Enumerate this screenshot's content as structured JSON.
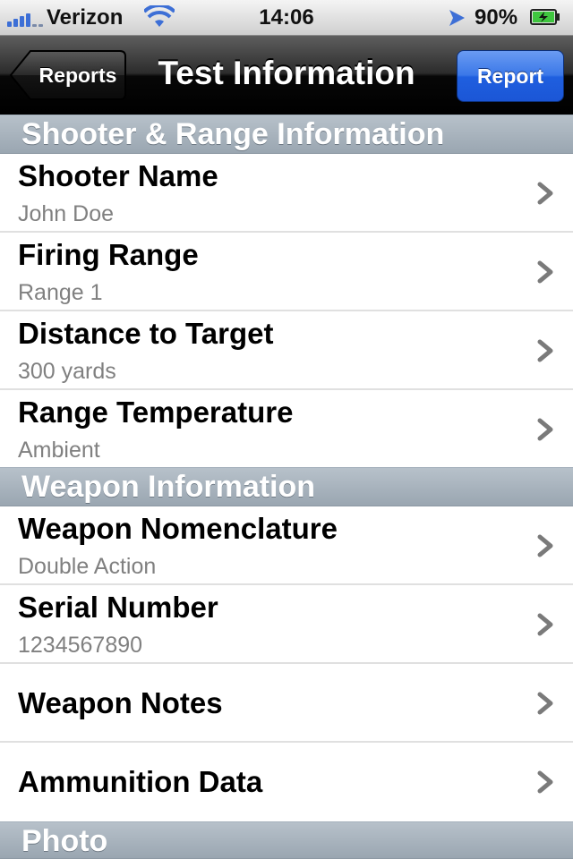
{
  "status_bar": {
    "carrier": "Verizon",
    "time": "14:06",
    "battery_percent": "90%",
    "signal_bars": 4,
    "icons": [
      "signal-icon",
      "wifi-icon",
      "location-arrow-icon",
      "battery-charging-icon"
    ]
  },
  "nav": {
    "back_label": "Reports",
    "title": "Test Information",
    "report_label": "Report"
  },
  "colors": {
    "section_header": "#a7b2bc",
    "report_button": "#2a66e0",
    "subtitle_text": "#808080",
    "chevron": "#7a7a7a"
  },
  "sections": [
    {
      "header": "Shooter & Range Information",
      "rows": [
        {
          "title": "Shooter Name",
          "subtitle": "John Doe"
        },
        {
          "title": "Firing Range",
          "subtitle": "Range 1"
        },
        {
          "title": "Distance to Target",
          "subtitle": "300 yards"
        },
        {
          "title": "Range Temperature",
          "subtitle": "Ambient"
        }
      ]
    },
    {
      "header": "Weapon Information",
      "rows": [
        {
          "title": "Weapon Nomenclature",
          "subtitle": "Double Action"
        },
        {
          "title": "Serial Number",
          "subtitle": "1234567890"
        },
        {
          "title": "Weapon Notes"
        },
        {
          "title": "Ammunition Data"
        }
      ]
    },
    {
      "header": "Photo",
      "rows": []
    }
  ]
}
